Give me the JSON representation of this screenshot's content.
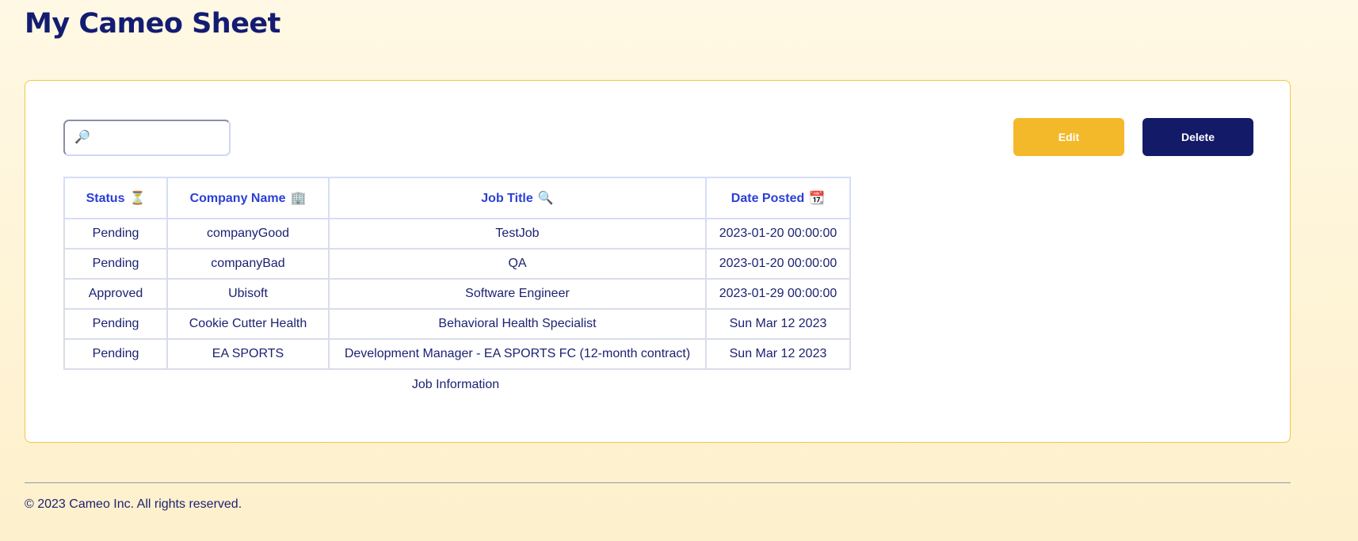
{
  "page": {
    "title": "My Cameo Sheet"
  },
  "toolbar": {
    "search_icon_glyph": "🔎",
    "search_value": "",
    "edit_label": "Edit",
    "delete_label": "Delete"
  },
  "table": {
    "headers": [
      {
        "label": "Status",
        "emoji": "⏳",
        "icon": "hourglass-icon"
      },
      {
        "label": "Company Name",
        "emoji": "🏢",
        "icon": "office-building-icon"
      },
      {
        "label": "Job Title",
        "emoji": "🔍",
        "icon": "magnifier-icon"
      },
      {
        "label": "Date Posted",
        "emoji": "📆",
        "icon": "calendar-icon"
      }
    ],
    "rows": [
      [
        "Pending",
        "companyGood",
        "TestJob",
        "2023-01-20 00:00:00"
      ],
      [
        "Pending",
        "companyBad",
        "QA",
        "2023-01-20 00:00:00"
      ],
      [
        "Approved",
        "Ubisoft",
        "Software Engineer",
        "2023-01-29 00:00:00"
      ],
      [
        "Pending",
        "Cookie Cutter Health",
        "Behavioral Health Specialist",
        "Sun Mar 12 2023"
      ],
      [
        "Pending",
        "EA SPORTS",
        "Development Manager - EA SPORTS FC (12-month contract)",
        "Sun Mar 12 2023"
      ]
    ],
    "caption": "Job Information"
  },
  "footer": {
    "copyright": "© 2023 Cameo Inc. All rights reserved."
  },
  "colors": {
    "title": "#141c72",
    "card_border": "#f0c842",
    "edit_button": "#f4b92a",
    "delete_button": "#131a67",
    "header_text": "#2b3fd6",
    "body_text": "#1c2272"
  }
}
